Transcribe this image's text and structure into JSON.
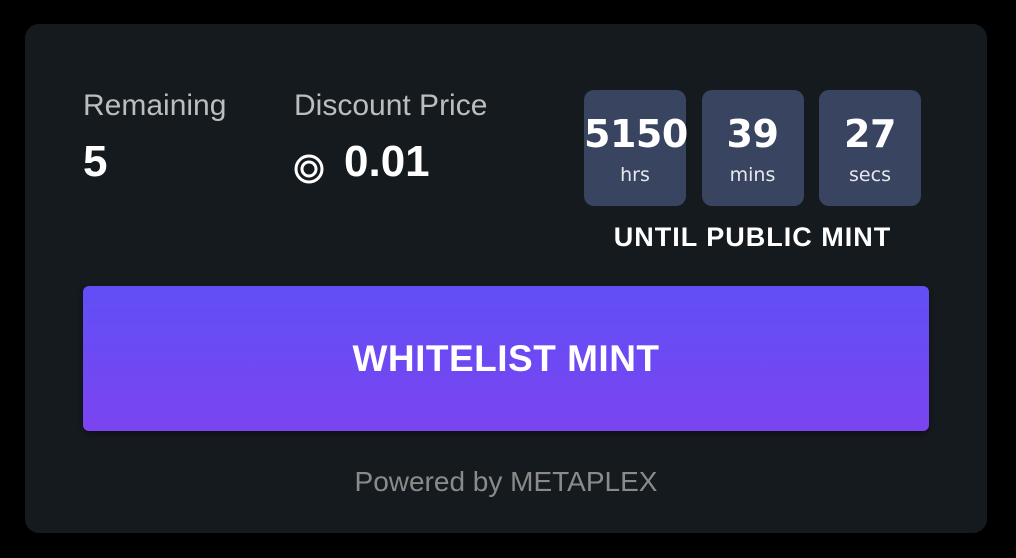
{
  "stats": {
    "remaining_label": "Remaining",
    "remaining_value": "5",
    "price_label": "Discount Price",
    "price_value": "0.01",
    "price_icon": "solana-coin-icon"
  },
  "countdown": {
    "hours": "5150",
    "hours_unit": "hrs",
    "minutes": "39",
    "minutes_unit": "mins",
    "seconds": "27",
    "seconds_unit": "secs",
    "caption": "UNTIL PUBLIC MINT"
  },
  "mint_button": {
    "label": "WHITELIST MINT"
  },
  "footer": {
    "powered_by": "Powered by METAPLEX"
  },
  "colors": {
    "page_bg": "#000000",
    "card_bg": "#151a1f",
    "timer_box_bg": "#384460",
    "button_gradient_top": "#604ff5",
    "button_gradient_bottom": "#7b44f1",
    "muted_text": "#8a8a8a"
  }
}
